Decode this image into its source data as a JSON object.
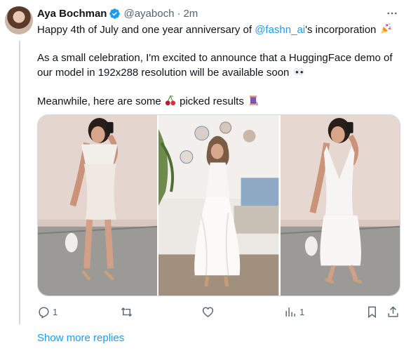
{
  "post": {
    "author_name": "Aya Bochman",
    "handle": "@ayaboch",
    "separator": "·",
    "time": "2m",
    "line1_prefix": "Happy 4th of July and one year anniversary of ",
    "line1_mention": "@fashn_ai",
    "line1_suffix": "'s incorporation",
    "para2": "As a small celebration, I'm excited to announce that a HuggingFace demo of our model in 192x288 resolution will be available soon",
    "para3_prefix": "Meanwhile, here are some",
    "para3_suffix": "picked results",
    "emojis": [
      "party-popper-icon",
      "eyes-icon",
      "cherries-icon",
      "thread-spool-icon"
    ]
  },
  "actions": {
    "reply_count": "1",
    "repost_count": "",
    "like_count": "",
    "views_count": "1"
  },
  "show_more_replies": "Show more replies",
  "colors": {
    "accent": "#1d9bf0",
    "secondary_text": "#536471",
    "primary_text": "#0f1419",
    "divider": "#cfd9de"
  }
}
